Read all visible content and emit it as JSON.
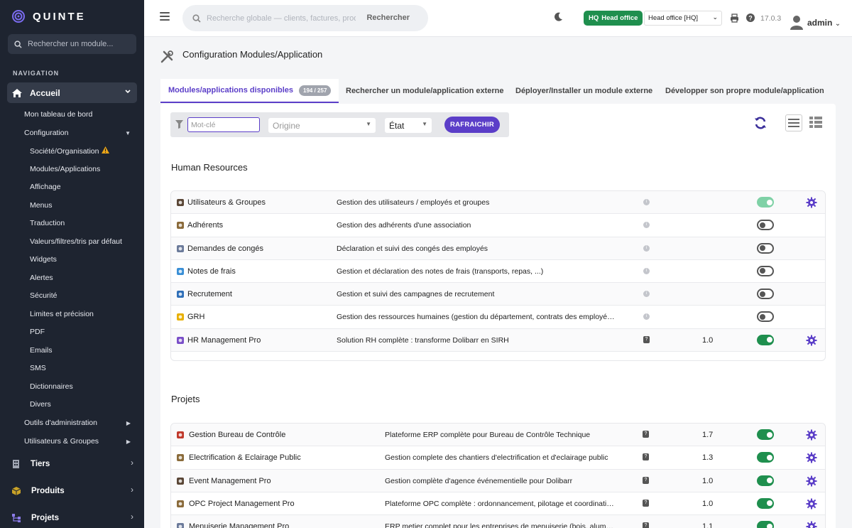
{
  "sidebar": {
    "brand": "QUINTE",
    "search_placeholder": "Rechercher un module...",
    "nav_heading": "NAVIGATION",
    "accueil": "Accueil",
    "tableau_de_bord": "Mon tableau de bord",
    "configuration": "Configuration",
    "config_items": [
      "Société/Organisation",
      "Modules/Applications",
      "Affichage",
      "Menus",
      "Traduction",
      "Valeurs/filtres/tris par défaut",
      "Widgets",
      "Alertes",
      "Sécurité",
      "Limites et précision",
      "PDF",
      "Emails",
      "SMS",
      "Dictionnaires",
      "Divers"
    ],
    "outils": "Outils d'administration",
    "utilisateurs": "Utilisateurs & Groupes",
    "main_items": [
      "Tiers",
      "Produits",
      "Projets"
    ]
  },
  "topbar": {
    "search_placeholder": "Recherche globale — clients, factures, prod",
    "search_button": "Rechercher",
    "hq_badge": "HQ",
    "hq_label": "Head office",
    "entity_select": "Head office [HQ]",
    "version": "17.0.3",
    "user": "admin"
  },
  "page": {
    "title": "Configuration Modules/Application",
    "tabs": [
      {
        "label": "Modules/applications disponibles",
        "badge": "194 / 257"
      },
      {
        "label": "Rechercher un module/application externe"
      },
      {
        "label": "Déployer/Installer un module externe"
      },
      {
        "label": "Développer son propre module/application"
      }
    ],
    "filters": {
      "keyword_placeholder": "Mot-clé",
      "origin": "Origine",
      "state": "État",
      "refresh": "RAFRAICHIR"
    }
  },
  "sections": [
    {
      "title": "Human Resources",
      "modules": [
        {
          "name": "Utilisateurs & Groupes",
          "desc": "Gestion des utilisateurs / employés et groupes",
          "version": "",
          "state": "locked",
          "settings": true
        },
        {
          "name": "Adhérents",
          "desc": "Gestion des adhérents d'une association",
          "version": "",
          "state": "off",
          "settings": false
        },
        {
          "name": "Demandes de congés",
          "desc": "Déclaration et suivi des congés des employés",
          "version": "",
          "state": "off",
          "settings": false
        },
        {
          "name": "Notes de frais",
          "desc": "Gestion et déclaration des notes de frais (transports, repas, ...)",
          "version": "",
          "state": "off",
          "settings": false
        },
        {
          "name": "Recrutement",
          "desc": "Gestion et suivi des campagnes de recrutement",
          "version": "",
          "state": "off",
          "settings": false
        },
        {
          "name": "GRH",
          "desc": "Gestion des ressources humaines (gestion du département, contrats des employés et sentiments)",
          "version": "",
          "state": "off",
          "settings": false
        },
        {
          "name": "HR Management Pro",
          "desc": "Solution RH complète : transforme Dolibarr en SIRH",
          "version": "1.0",
          "state": "on",
          "settings": true
        }
      ]
    },
    {
      "title": "Projets",
      "modules": [
        {
          "name": "Gestion Bureau de Contrôle",
          "desc": "Plateforme ERP complète pour Bureau de Contrôle Technique",
          "version": "1.7",
          "state": "on",
          "settings": true
        },
        {
          "name": "Electrification & Eclairage Public",
          "desc": "Gestion complete des chantiers d'electrification et d'eclairage public",
          "version": "1.3",
          "state": "on",
          "settings": true
        },
        {
          "name": "Event Management Pro",
          "desc": "Gestion complète d'agence événementielle pour Dolibarr",
          "version": "1.0",
          "state": "on",
          "settings": true
        },
        {
          "name": "OPC Project Management Pro",
          "desc": "Plateforme OPC complète : ordonnancement, pilotage et coordination de chantiers",
          "version": "1.0",
          "state": "on",
          "settings": true
        },
        {
          "name": "Menuiserie Management Pro",
          "desc": "ERP metier complet pour les entreprises de menuiserie (bois, aluminium)",
          "version": "1.1",
          "state": "on",
          "settings": true
        }
      ]
    }
  ],
  "colors": {
    "accent": "#5b3ec8",
    "sidebar_bg": "#1e2430",
    "toggle_on": "#1f8f4e",
    "hq_badge": "#1f8f4e"
  }
}
